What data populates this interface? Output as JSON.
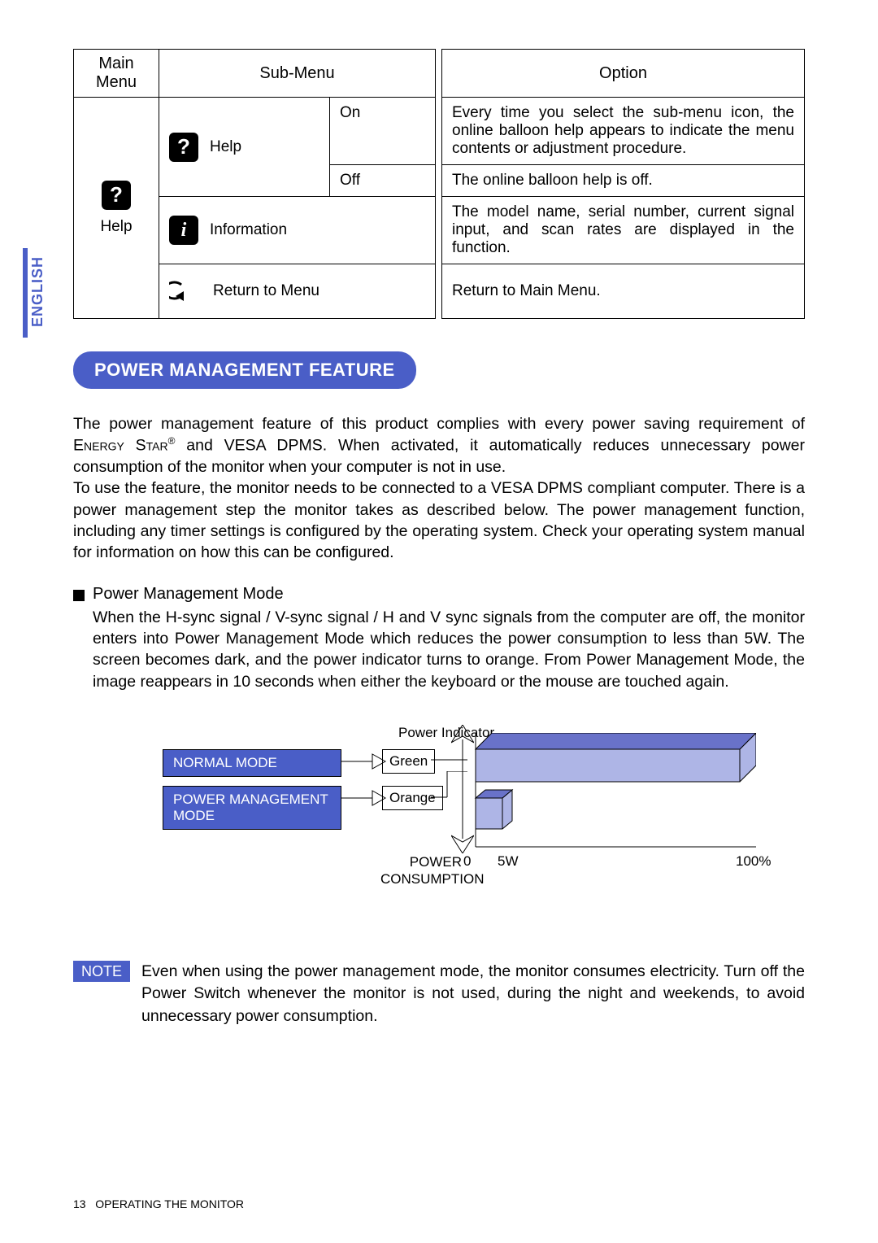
{
  "lang": "ENGLISH",
  "table": {
    "headers": {
      "main": "Main Menu",
      "sub": "Sub-Menu",
      "option": "Option"
    },
    "main_label": "Help",
    "rows": {
      "help": {
        "sub_label": "Help",
        "on": "On",
        "on_desc": "Every time you select the sub-menu icon, the online balloon help appears to indicate the menu contents or adjustment procedure.",
        "off": "Off",
        "off_desc": "The online balloon help is off."
      },
      "info": {
        "sub_label": "Information",
        "desc": "The model name, serial number, current signal input, and scan rates are displayed in the function."
      },
      "return": {
        "sub_label": "Return to Menu",
        "desc": "Return to Main Menu."
      }
    }
  },
  "section_title": "POWER MANAGEMENT FEATURE",
  "para1_a": "The power management feature of this product complies with every power saving requirement of ",
  "para1_b": "Energy Star",
  "para1_c": " and VESA DPMS. When activated, it automatically reduces unnecessary power consumption of the monitor when your computer is not in use.",
  "para2": "To use the feature, the monitor needs to be connected to a VESA DPMS compliant computer. There is a power management step the monitor takes as described below. The power management function, including any timer settings is configured by the operating system. Check your operating system manual for information on how this can be configured.",
  "bullet_title": "Power Management Mode",
  "bullet_body": "When the H-sync signal / V-sync signal / H and V sync signals from the computer are off, the monitor enters into Power Management Mode which reduces the power consumption to less than 5W. The screen becomes dark, and the power indicator turns to orange. From Power Management  Mode, the image reappears in 10 seconds when either the keyboard or the mouse are touched again.",
  "diagram": {
    "power_indicator": "Power Indicator",
    "normal": "NORMAL MODE",
    "pm": "POWER MANAGEMENT MODE",
    "green": "Green",
    "orange": "Orange",
    "power_consumption": "POWER CONSUMPTION",
    "t0": "0",
    "t5": "5W",
    "t100": "100%"
  },
  "chart_data": {
    "type": "bar",
    "title": "Power Consumption vs Mode",
    "xlabel": "POWER CONSUMPTION",
    "ylabel": "Power Indicator",
    "series": [
      {
        "name": "NORMAL MODE",
        "indicator": "Green",
        "value": 100,
        "unit": "%"
      },
      {
        "name": "POWER MANAGEMENT MODE",
        "indicator": "Orange",
        "value": 5,
        "unit": "W"
      }
    ],
    "xlim": [
      0,
      100
    ]
  },
  "note_label": "NOTE",
  "note_text": "Even when using the power management mode, the monitor consumes electricity. Turn off the Power Switch whenever the monitor is not used, during the night and weekends, to avoid unnecessary power consumption.",
  "footer_page": "13",
  "footer_title": "OPERATING THE MONITOR"
}
